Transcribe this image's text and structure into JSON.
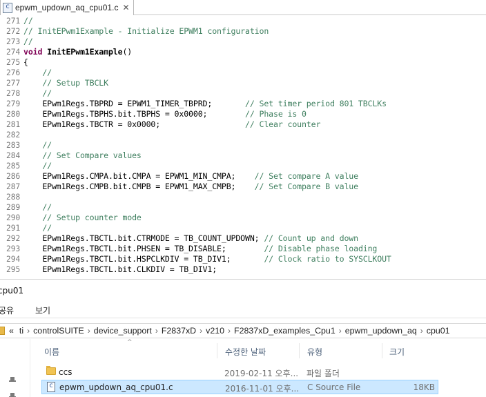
{
  "editor": {
    "tab": {
      "title": "epwm_updown_aq_cpu01.c",
      "close": "✕",
      "icon": "c-file-icon"
    },
    "lines": [
      {
        "num": "271",
        "parts": [
          {
            "t": "//",
            "k": "c"
          }
        ]
      },
      {
        "num": "272",
        "parts": [
          {
            "t": "// InitEPwm1Example - Initialize EPWM1 configuration",
            "k": "c"
          }
        ]
      },
      {
        "num": "273",
        "parts": [
          {
            "t": "//",
            "k": "c"
          }
        ]
      },
      {
        "num": "274",
        "parts": [
          {
            "t": "void",
            "k": "kw"
          },
          {
            "t": " InitEPwm1Example",
            "k": "fn"
          },
          {
            "t": "()",
            "k": ""
          }
        ]
      },
      {
        "num": "275",
        "parts": [
          {
            "t": "{",
            "k": ""
          }
        ]
      },
      {
        "num": "276",
        "parts": [
          {
            "t": "    //",
            "k": "c"
          }
        ]
      },
      {
        "num": "277",
        "parts": [
          {
            "t": "    // Setup TBCLK",
            "k": "c"
          }
        ]
      },
      {
        "num": "278",
        "parts": [
          {
            "t": "    //",
            "k": "c"
          }
        ]
      },
      {
        "num": "279",
        "parts": [
          {
            "t": "    EPwm1Regs.TBPRD = EPWM1_TIMER_TBPRD;       ",
            "k": ""
          },
          {
            "t": "// Set timer period 801 TBCLKs",
            "k": "c"
          }
        ]
      },
      {
        "num": "280",
        "parts": [
          {
            "t": "    EPwm1Regs.TBPHS.bit.TBPHS = 0x0000;        ",
            "k": ""
          },
          {
            "t": "// Phase is 0",
            "k": "c"
          }
        ]
      },
      {
        "num": "281",
        "parts": [
          {
            "t": "    EPwm1Regs.TBCTR = 0x0000;                  ",
            "k": ""
          },
          {
            "t": "// Clear counter",
            "k": "c"
          }
        ]
      },
      {
        "num": "282",
        "parts": []
      },
      {
        "num": "283",
        "parts": [
          {
            "t": "    //",
            "k": "c"
          }
        ]
      },
      {
        "num": "284",
        "parts": [
          {
            "t": "    // Set Compare values",
            "k": "c"
          }
        ]
      },
      {
        "num": "285",
        "parts": [
          {
            "t": "    //",
            "k": "c"
          }
        ]
      },
      {
        "num": "286",
        "parts": [
          {
            "t": "    EPwm1Regs.CMPA.bit.CMPA = EPWM1_MIN_CMPA;    ",
            "k": ""
          },
          {
            "t": "// Set compare A value",
            "k": "c"
          }
        ]
      },
      {
        "num": "287",
        "parts": [
          {
            "t": "    EPwm1Regs.CMPB.bit.CMPB = EPWM1_MAX_CMPB;    ",
            "k": ""
          },
          {
            "t": "// Set Compare B value",
            "k": "c"
          }
        ]
      },
      {
        "num": "288",
        "parts": []
      },
      {
        "num": "289",
        "parts": [
          {
            "t": "    //",
            "k": "c"
          }
        ]
      },
      {
        "num": "290",
        "parts": [
          {
            "t": "    // Setup counter mode",
            "k": "c"
          }
        ]
      },
      {
        "num": "291",
        "parts": [
          {
            "t": "    //",
            "k": "c"
          }
        ]
      },
      {
        "num": "292",
        "parts": [
          {
            "t": "    EPwm1Regs.TBCTL.bit.CTRMODE = TB_COUNT_UPDOWN; ",
            "k": ""
          },
          {
            "t": "// Count up and down",
            "k": "c"
          }
        ]
      },
      {
        "num": "293",
        "parts": [
          {
            "t": "    EPwm1Regs.TBCTL.bit.PHSEN = TB_DISABLE;        ",
            "k": ""
          },
          {
            "t": "// Disable phase loading",
            "k": "c"
          }
        ]
      },
      {
        "num": "294",
        "parts": [
          {
            "t": "    EPwm1Regs.TBCTL.bit.HSPCLKDIV = TB_DIV1;       ",
            "k": ""
          },
          {
            "t": "// Clock ratio to SYSCLKOUT",
            "k": "c"
          }
        ]
      },
      {
        "num": "295",
        "parts": [
          {
            "t": "    EPwm1Regs.TBCTL.bit.CLKDIV = TB_DIV1;",
            "k": ""
          }
        ]
      }
    ]
  },
  "explorer": {
    "title": "cpu01",
    "ribbon": {
      "share": "공유",
      "view": "보기"
    },
    "address": {
      "back": "«",
      "crumbs": [
        "ti",
        "controlSUITE",
        "device_support",
        "F2837xD",
        "v210",
        "F2837xD_examples_Cpu1",
        "epwm_updown_aq",
        "cpu01"
      ],
      "separator": "›"
    },
    "columns": {
      "name": "이름",
      "date": "수정한 날짜",
      "type": "유형",
      "size": "크기",
      "sort_arrow": "^"
    },
    "rows": [
      {
        "icon": "folder-icon",
        "name": "ccs",
        "date": "2019-02-11 오후...",
        "type": "파일 폴더",
        "size": ""
      },
      {
        "icon": "c-file-icon",
        "name": "epwm_updown_aq_cpu01.c",
        "date": "2016-11-01 오후...",
        "type": "C Source File",
        "size": "18KB"
      }
    ],
    "colors": {
      "selection": "#cce8ff",
      "selection_border": "#99d1ff"
    }
  },
  "colors": {
    "comment": "#3f7f5f",
    "keyword": "#7f0055",
    "line_number": "#787878"
  }
}
